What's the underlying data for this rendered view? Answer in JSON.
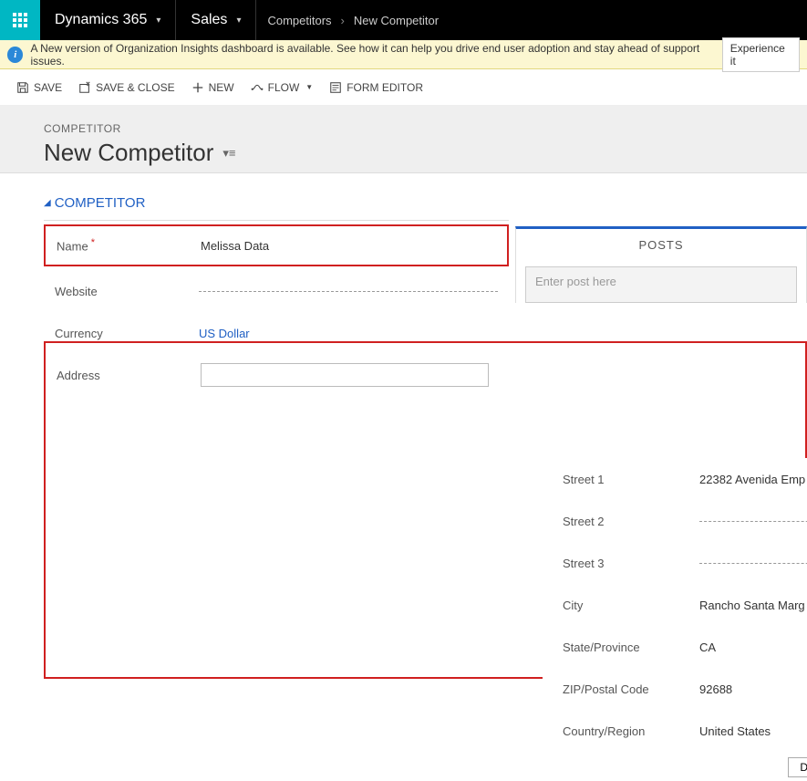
{
  "topnav": {
    "brand": "Dynamics 365",
    "area": "Sales",
    "breadcrumb_parent": "Competitors",
    "breadcrumb_current": "New Competitor"
  },
  "notification": {
    "text": "A New version of Organization Insights dashboard is available. See how it can help you drive end user adoption and stay ahead of support issues.",
    "action": "Experience it"
  },
  "commands": {
    "save": "SAVE",
    "save_close": "SAVE & CLOSE",
    "new": "NEW",
    "flow": "FLOW",
    "form_editor": "FORM EDITOR"
  },
  "header": {
    "entity": "COMPETITOR",
    "title": "New Competitor"
  },
  "section": {
    "title": "COMPETITOR"
  },
  "fields": {
    "name_label": "Name",
    "name_value": "Melissa Data",
    "website_label": "Website",
    "currency_label": "Currency",
    "currency_value": "US Dollar",
    "address_label": "Address"
  },
  "posts": {
    "header": "POSTS",
    "placeholder": "Enter post here"
  },
  "address_flyout": {
    "street1_label": "Street 1",
    "street1_value": "22382 Avenida Emp",
    "street2_label": "Street 2",
    "street3_label": "Street 3",
    "city_label": "City",
    "city_value": "Rancho Santa Marg",
    "state_label": "State/Province",
    "state_value": "CA",
    "zip_label": "ZIP/Postal Code",
    "zip_value": "92688",
    "country_label": "Country/Region",
    "country_value": "United States",
    "done": "Done"
  }
}
